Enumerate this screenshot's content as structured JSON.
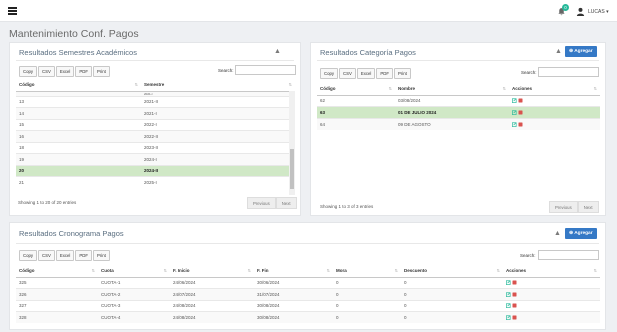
{
  "header": {
    "user_name": "LUCAS",
    "notification_count": "0",
    "user_caret": "▾"
  },
  "page": {
    "title": "Mantenimiento Conf. Pagos"
  },
  "export_buttons": [
    "Copy",
    "CSV",
    "Excel",
    "PDF",
    "Print"
  ],
  "search_label": "Search:",
  "semestres": {
    "title": "Resultados Semestres Académicos",
    "columns": [
      "Código",
      "Semestre"
    ],
    "rows": [
      [
        "",
        "2021-I"
      ],
      [
        "13",
        "2021-II"
      ],
      [
        "14",
        "2021-I"
      ],
      [
        "15",
        "2022-I"
      ],
      [
        "16",
        "2022-II"
      ],
      [
        "18",
        "2023-II"
      ],
      [
        "19",
        "2024-I"
      ],
      [
        "20",
        "2024-II"
      ],
      [
        "21",
        "2025-I"
      ]
    ],
    "highlight_row": 7,
    "info": "Showing 1 to 20 of 20 entries",
    "prev": "Previous",
    "next": "Next",
    "collapse": "▲"
  },
  "categoria": {
    "title": "Resultados Categoría Pagos",
    "columns": [
      "Código",
      "Nombre",
      "Acciones"
    ],
    "rows": [
      [
        "62",
        "03/08/2024"
      ],
      [
        "63",
        "01 DE JULIO 2024"
      ],
      [
        "64",
        "09 DE AGOSTO"
      ]
    ],
    "highlight_row": 1,
    "info": "Showing 1 to 3 of 3 entries",
    "prev": "Previous",
    "next": "Next",
    "add_label": "Agregar",
    "collapse": "▲"
  },
  "cronograma": {
    "title": "Resultados Cronograma Pagos",
    "columns": [
      "Código",
      "Cuota",
      "F. Inicio",
      "F. Fin",
      "Mora",
      "Descuento",
      "Acciones"
    ],
    "rows": [
      [
        "325",
        "CUOTA-1",
        "24/06/2024",
        "30/06/2024",
        "0",
        "0"
      ],
      [
        "326",
        "CUOTA-2",
        "24/07/2024",
        "31/07/2024",
        "0",
        "0"
      ],
      [
        "327",
        "CUOTA-3",
        "24/08/2024",
        "30/08/2024",
        "0",
        "0"
      ],
      [
        "328",
        "CUOTA-4",
        "24/08/2024",
        "30/08/2024",
        "0",
        "0"
      ]
    ],
    "add_label": "Agregar",
    "collapse": "▲"
  },
  "colors": {
    "accent": "#3579c6",
    "highlight": "#d0e8c6",
    "edit": "#26b99a",
    "delete": "#d9534f"
  }
}
